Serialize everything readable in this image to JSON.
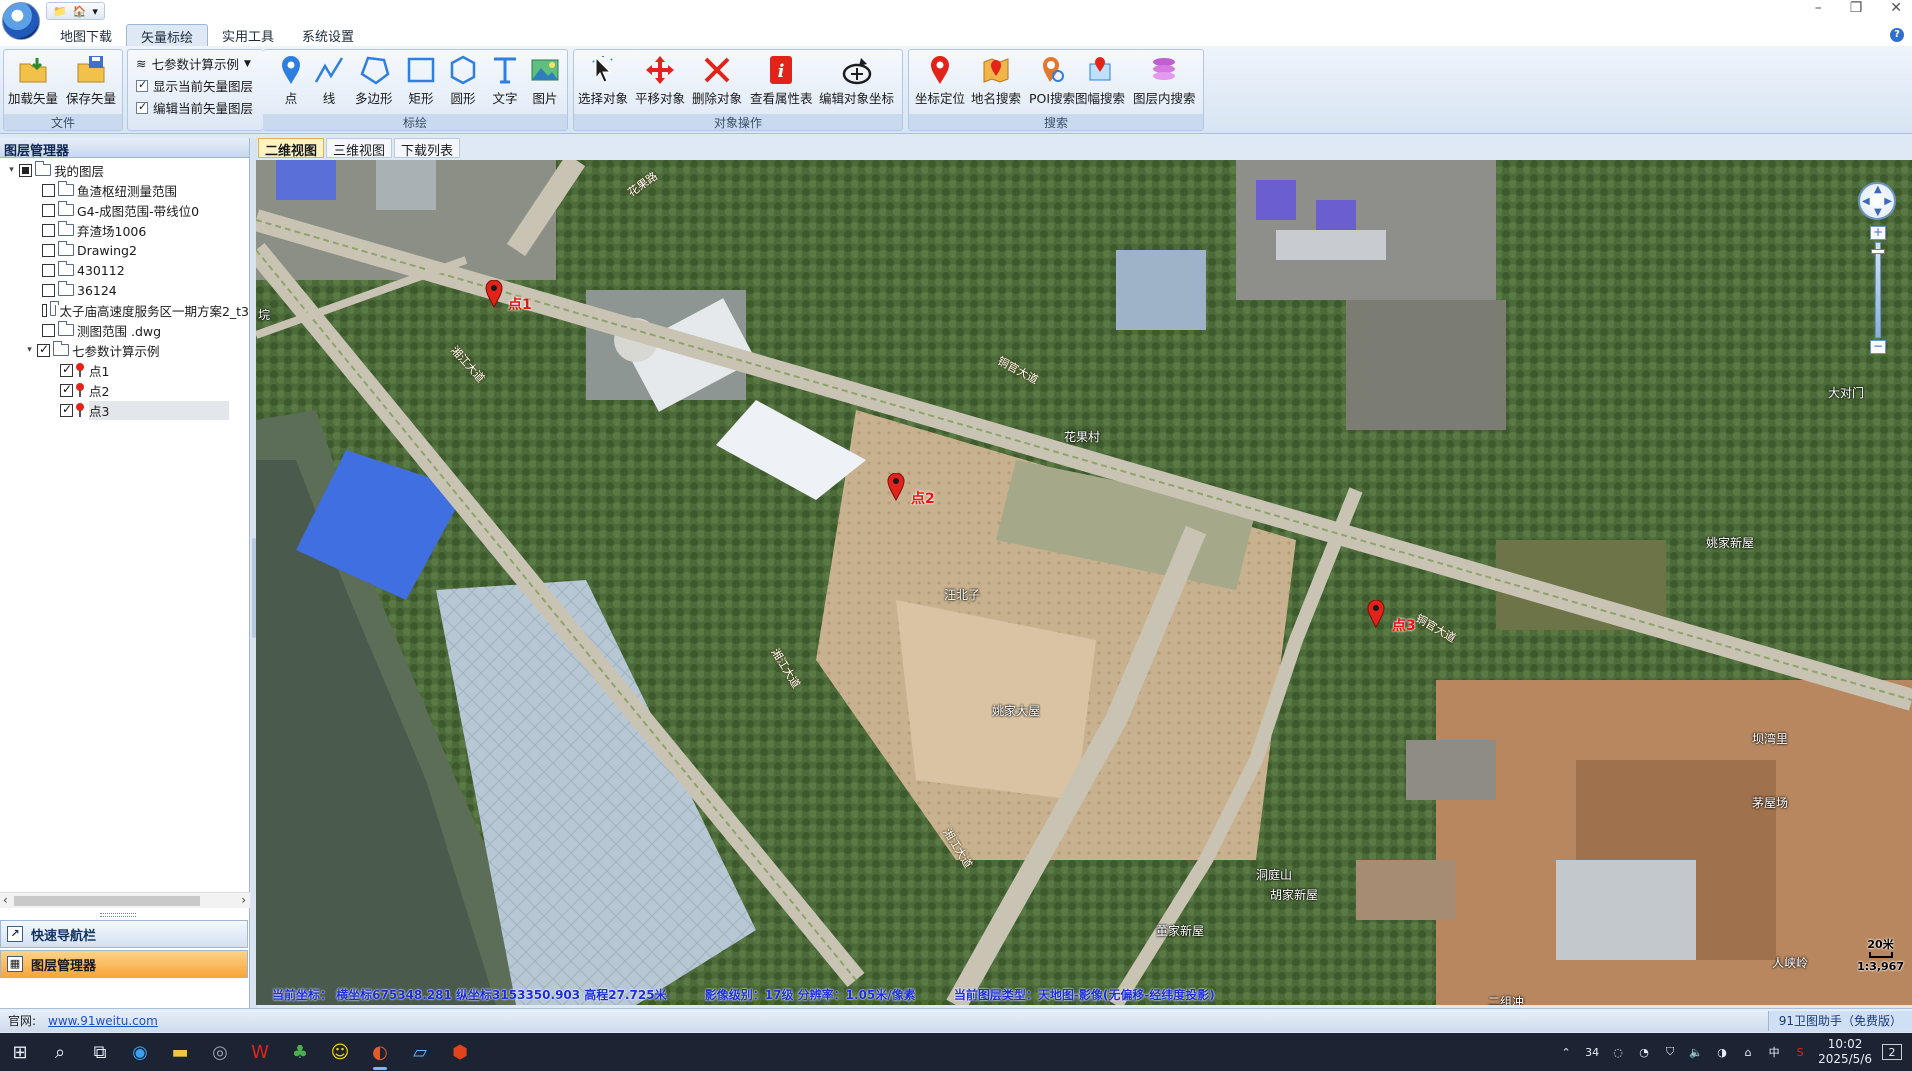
{
  "tabs": [
    "地图下载",
    "矢量标绘",
    "实用工具",
    "系统设置"
  ],
  "active_tab_index": 1,
  "ribbon": {
    "file_group": {
      "label": "文件",
      "load": "加载矢量",
      "save": "保存矢量"
    },
    "layer_dropdown": "七参数计算示例",
    "checks": [
      {
        "label": "显示当前矢量图层",
        "checked": true
      },
      {
        "label": "编辑当前矢量图层",
        "checked": true
      }
    ],
    "draw_group": {
      "label": "标绘",
      "buttons": [
        "点",
        "线",
        "多边形",
        "矩形",
        "圆形",
        "文字",
        "图片"
      ]
    },
    "object_group": {
      "label": "对象操作",
      "buttons": [
        "选择对象",
        "平移对象",
        "删除对象",
        "查看属性表",
        "编辑对象坐标"
      ]
    },
    "search_group": {
      "label": "搜索",
      "buttons": [
        "坐标定位",
        "地名搜索",
        "POI搜索",
        "图幅搜索",
        "图层内搜索"
      ]
    }
  },
  "layer_panel": {
    "title": "图层管理器",
    "root": "我的图层",
    "layers": [
      "鱼渣枢纽测量范围",
      "G4-成图范围-带线位0",
      "弃渣场1006",
      "Drawing2",
      "430112",
      "36124",
      "太子庙高速度服务区一期方案2_t3",
      "测图范围 .dwg",
      "七参数计算示例"
    ],
    "points": [
      "点1",
      "点2",
      "点3"
    ],
    "selected_point": "点3"
  },
  "nav": {
    "quick": "快速导航栏",
    "layer_manager": "图层管理器"
  },
  "view_tabs": [
    "二维视图",
    "三维视图",
    "下载列表"
  ],
  "active_view_tab": 0,
  "map": {
    "markers": [
      "点1",
      "点2",
      "点3"
    ],
    "place_labels": [
      "花果路",
      "湘江大道",
      "铜官大道",
      "花果村",
      "汪北子",
      "姚家大屋",
      "姚家新屋",
      "坝湾里",
      "茅屋场",
      "洞庭山",
      "胡家新屋",
      "董家新屋",
      "人峡岭",
      "大对门",
      "二组冲",
      "垸"
    ],
    "scale_label": "20米",
    "scale_ratio": "1:3,967"
  },
  "map_status": {
    "coords": "当前坐标： 横坐标675348.281 纵坐标3153350.903 高程27.725米",
    "level": "影像级别：17级 分辨率：1.05米/像素",
    "layer_type": "当前图层类型：天地图-影像(无偏移-经纬度投影)"
  },
  "statusbar": {
    "site_label": "官网:",
    "site_link": "www.91weitu.com",
    "right": "91卫图助手（免费版）"
  },
  "taskbar": {
    "tray_num": "34",
    "ime": "中",
    "time": "10:02",
    "date": "2025/5/6",
    "notif": "2"
  }
}
